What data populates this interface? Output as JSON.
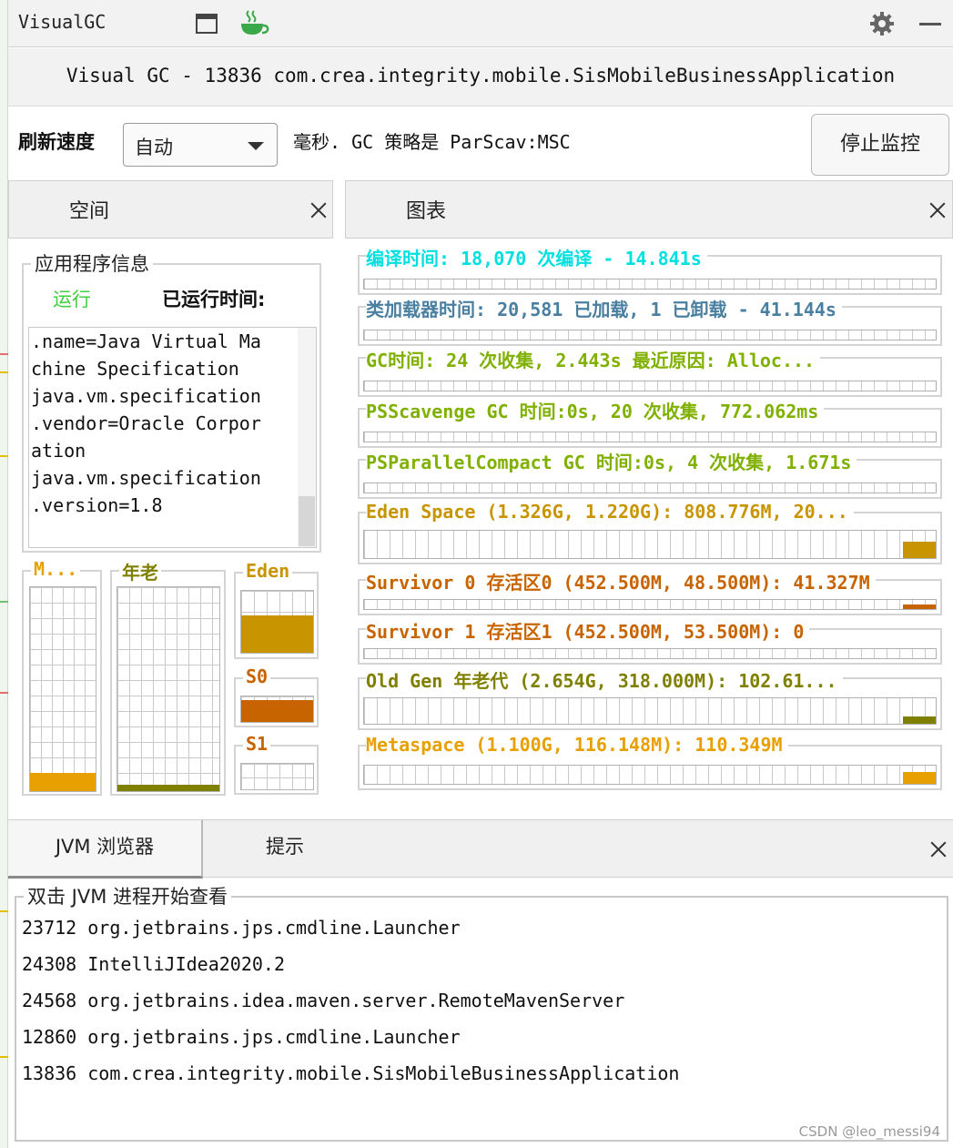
{
  "window": {
    "title": "VisualGC",
    "icons": [
      "window-icon",
      "coffee-cup-icon",
      "gear-icon",
      "minimize-icon"
    ]
  },
  "header": {
    "title": "Visual GC - 13836 com.crea.integrity.mobile.SisMobileBusinessApplication"
  },
  "refresh": {
    "label": "刷新速度",
    "selected": "自动",
    "policy_text": "毫秒. GC 策略是 ParScav:MSC",
    "stop_button": "停止监控"
  },
  "tabs": {
    "space": "空间",
    "chart": "图表",
    "jvm_browser": "JVM 浏览器",
    "hints": "提示"
  },
  "app_info": {
    "title": "应用程序信息",
    "status": "运行",
    "uptime_label": "已运行时间:",
    "properties_text": ".name=Java Virtual Ma\nchine Specification\njava.vm.specification\n.vendor=Oracle Corpor\nation\njava.vm.specification\n.version=1.8"
  },
  "memory": {
    "metaspace": {
      "label": "M...",
      "fill": 0.09,
      "color": "#e8a000"
    },
    "old": {
      "label": "年老",
      "fill": 0.03,
      "color": "#808000"
    },
    "eden": {
      "label": "Eden",
      "fill": 0.6,
      "color": "#c89400"
    },
    "s0": {
      "label": "S0",
      "fill": 0.85,
      "color": "#c86400"
    },
    "s1": {
      "label": "S1",
      "fill": 0
    }
  },
  "charts": [
    {
      "title": "编译时间: 18,070 次编译 - 14.841s",
      "color": "#00e0e0",
      "fill": 0.012
    },
    {
      "title": "类加载器时间: 20,581 已加载, 1 已卸载 - 41.144s",
      "color": "#4a7fa0",
      "fill": 0
    },
    {
      "title": "GC时间: 24 次收集, 2.443s  最近原因: Alloc...",
      "color": "#80b000",
      "fill": 0
    },
    {
      "title": "PSScavenge GC 时间:0s, 20 次收集, 772.062ms",
      "color": "#80b000",
      "fill": 0
    },
    {
      "title": "PSParallelCompact GC 时间:0s, 4 次收集, 1.671s",
      "color": "#80b000",
      "fill": 0
    },
    {
      "title": "Eden Space (1.326G, 1.220G): 808.776M, 20...",
      "color": "#c89400",
      "fill": 0.55
    },
    {
      "title": "Survivor 0 存活区0 (452.500M, 48.500M): 41.327M",
      "color": "#c86400",
      "fill": 0.45
    },
    {
      "title": "Survivor 1 存活区1 (452.500M, 53.500M): 0",
      "color": "#c86400",
      "fill": 0
    },
    {
      "title": "Old Gen 年老代 (2.654G, 318.000M): 102.61...",
      "color": "#808000",
      "fill": 0.25
    },
    {
      "title": "Metaspace (1.100G, 116.148M): 110.349M",
      "color": "#e8a000",
      "fill": 0.6
    }
  ],
  "jvm_browser": {
    "title": "双击 JVM 进程开始查看",
    "processes": [
      "23712 org.jetbrains.jps.cmdline.Launcher",
      "24308 IntelliJIdea2020.2",
      "24568 org.jetbrains.idea.maven.server.RemoteMavenServer",
      "12860 org.jetbrains.jps.cmdline.Launcher",
      "13836 com.crea.integrity.mobile.SisMobileBusinessApplication"
    ]
  },
  "watermark": "CSDN @leo_messi94"
}
